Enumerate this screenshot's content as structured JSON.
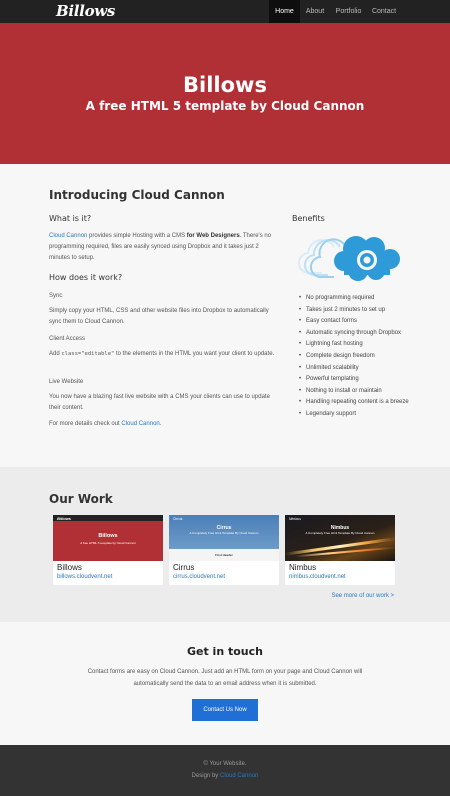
{
  "nav": {
    "logo": "Billows",
    "items": [
      "Home",
      "About",
      "Portfolio",
      "Contact"
    ]
  },
  "hero": {
    "title": "Billows",
    "subtitle": "A free HTML 5 template by Cloud Cannon"
  },
  "intro": {
    "heading": "Introducing Cloud Cannon",
    "what_heading": "What is it?",
    "what_link": "Cloud Cannon",
    "what_text_1": " provides simple Hosting with a CMS ",
    "what_bold": "for Web Designers",
    "what_text_2": ". There's no programming required, files are easily synced using Dropbox and it takes just 2 minutes to setup.",
    "how_heading": "How does it work?",
    "sync_label": "Sync",
    "sync_text": "Simply copy your HTML, CSS and other website files into Dropbox to automatically sync them to Cloud Cannon.",
    "access_label": "Client Access",
    "access_text_1": "Add ",
    "access_code": "class=\"editable\"",
    "access_text_2": " to the elements in the HTML you want your client to update.",
    "live_label": "Live Website",
    "live_text": "You now have a blazing fast live website with a CMS your clients can use to update their content.",
    "more_text": "For more details check out ",
    "more_link": "Cloud Cannon",
    "more_end": ".",
    "benefits_heading": "Benefits",
    "benefits": [
      "No programming required",
      "Takes just 2 minutes to set up",
      "Easy contact forms",
      "Automatic syncing through Dropbox",
      "Lightning fast hosting",
      "Complete design freedom",
      "Unlimited scalability",
      "Powerful templating",
      "Nothing to install or maintain",
      "Handling repeating content is a breeze",
      "Legendary support"
    ]
  },
  "work": {
    "heading": "Our Work",
    "items": [
      {
        "title": "Billows",
        "url": "billows.cloudvent.net",
        "thumb_title": "Billows",
        "thumb_sub": "A free HTML 5 template by Cloud Cannon"
      },
      {
        "title": "Cirrus",
        "url": "cirrus.cloudvent.net",
        "thumb_title": "Cirrus",
        "thumb_sub": "A Completely Free Html Template By Cloud Cannon",
        "thumb_extra": "First Header"
      },
      {
        "title": "Nimbus",
        "url": "nimbus.cloudvent.net",
        "thumb_title": "Nimbus",
        "thumb_sub": "A Completely Free Html Template By Cloud Cannon"
      }
    ],
    "see_more": "See more of our work >"
  },
  "contact": {
    "heading": "Get in touch",
    "text": "Contact forms are easy on Cloud Cannon. Just add an HTML form on your page and Cloud Cannon will automatically send the data to an email address when it is submitted.",
    "button": "Contact Us Now"
  },
  "footer": {
    "copyright": "© Your Website.",
    "design_by": "Design by ",
    "design_link": "Cloud Cannon"
  },
  "colors": {
    "hero_bg": "#b03036",
    "link": "#2a78c2",
    "button": "#1f6fd6",
    "nav_bg": "#222222",
    "cloud_blue": "#2f9ad8"
  }
}
